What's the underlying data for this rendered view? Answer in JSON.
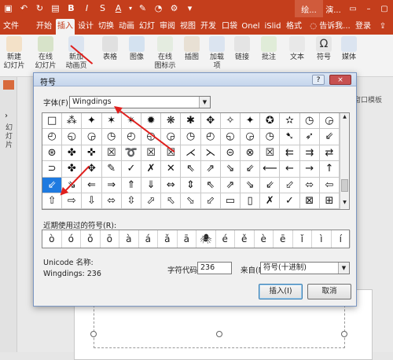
{
  "titlebar": {
    "doc_title": "绘...",
    "app_title": "演...",
    "qat_icons": [
      "save-icon",
      "undo-icon",
      "redo-icon",
      "present-icon",
      "bold-icon",
      "font-color-icon",
      "shadow-icon",
      "painter-icon",
      "shapes-icon",
      "gear-icon",
      "customize-icon"
    ]
  },
  "ribbon_tabs": [
    "文件",
    "开始",
    "插入",
    "设计",
    "切换",
    "动画",
    "幻灯",
    "审阅",
    "视图",
    "开发",
    "口袋",
    "Onel",
    "iSlid",
    "格式"
  ],
  "active_tab": "插入",
  "tell_me": "告诉我...",
  "login": "登录",
  "ribbon_buttons": [
    "新建\n幻灯片",
    "在线\n幻灯片",
    "新加\n动画页",
    "表格",
    "图像",
    "在线\n图标示",
    "插图",
    "加载\n项",
    "链接",
    "批注",
    "文本",
    "符号",
    "媒体"
  ],
  "slide_panel_label": "幻灯片",
  "right_partial": "窗口模板",
  "dialog": {
    "title": "符号",
    "help": "?",
    "close": "×",
    "font_label": "字体(F):",
    "font_value": "Wingdings",
    "symbols": [
      [
        "□",
        "⁂",
        "✦",
        "✶",
        "✴",
        "✹",
        "❋",
        "✱",
        "✥",
        "✧",
        "✦",
        "✪",
        "✫",
        "◷",
        "◶"
      ],
      [
        "◴",
        "◵",
        "◶",
        "◷",
        "◴",
        "◵",
        "◶",
        "◷",
        "◴",
        "◵",
        "◶",
        "◷",
        "➷",
        "➶",
        "⇙"
      ],
      [
        "⊛",
        "✤",
        "✜",
        "☒",
        "➰",
        "☒",
        "☒",
        "⋌",
        "⋋",
        "⊝",
        "⊗",
        "☒",
        "⇇",
        "⇉",
        "⇄"
      ],
      [
        "⊃",
        "✤",
        "✥",
        "✎",
        "✓",
        "✗",
        "✕",
        "⇖",
        "⇗",
        "⇘",
        "⇙",
        "⟵",
        "←",
        "→",
        "↑"
      ],
      [
        "⇙",
        "⇘",
        "⇐",
        "⇒",
        "⇑",
        "⇓",
        "⇔",
        "⇕",
        "⇖",
        "⇗",
        "⇘",
        "⇙",
        "⬃",
        "⬄",
        "⇦"
      ],
      [
        "⇧",
        "⇨",
        "⇩",
        "⬄",
        "⇳",
        "⬀",
        "⬁",
        "⬂",
        "⬃",
        "▭",
        "▯",
        "✗",
        "✓",
        "⊠",
        "⊞"
      ]
    ],
    "recent_label": "近期使用过的符号(R):",
    "recent": [
      "ò",
      "ó",
      "ǒ",
      "ō",
      "à",
      "á",
      "ǎ",
      "ā",
      "🕷",
      "é",
      "ě",
      "è",
      "ē",
      "ǐ",
      "ì",
      "í"
    ],
    "unicode_name_label": "Unicode 名称:",
    "unicode_name_value": "Wingdings: 236",
    "charcode_label": "字符代码(C):",
    "charcode_value": "236",
    "from_label": "来自(M):",
    "from_value": "符号(十进制)",
    "insert_button": "插入(I)",
    "cancel_button": "取消"
  }
}
